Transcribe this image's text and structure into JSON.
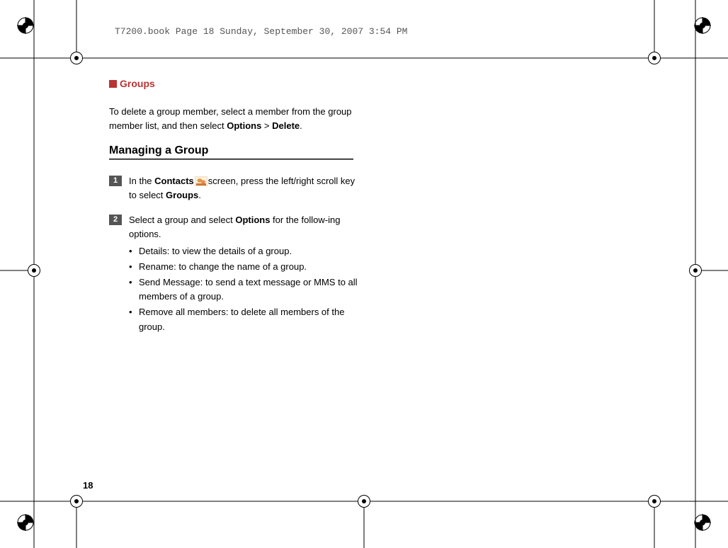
{
  "header": {
    "running_text": "T7200.book  Page 18  Sunday, September 30, 2007  3:54 PM"
  },
  "section": {
    "marker_color": "#b93334",
    "title": "Groups"
  },
  "intro": {
    "text_1": "To delete a group member, select a member from the group member list, and then select ",
    "options": "Options",
    "gt": " > ",
    "delete": "Delete",
    "period": "."
  },
  "sub_heading": "Managing a Group",
  "steps": [
    {
      "num": "1",
      "pre": "In the ",
      "contacts": "Contacts",
      "post": "screen, press the left/right scroll key to select ",
      "groups": "Groups",
      "period2": "."
    },
    {
      "num": "2",
      "text_a": "Select a group and select ",
      "options": "Options",
      "text_b": " for the follow-​ing options.",
      "bullets": [
        "Details: to view the details of a group.",
        "Rename: to change the name of a group.",
        "Send Message: to send a text message or MMS to all members of a group.",
        "Remove all members: to delete all members of the group."
      ]
    }
  ],
  "page_number": "18"
}
